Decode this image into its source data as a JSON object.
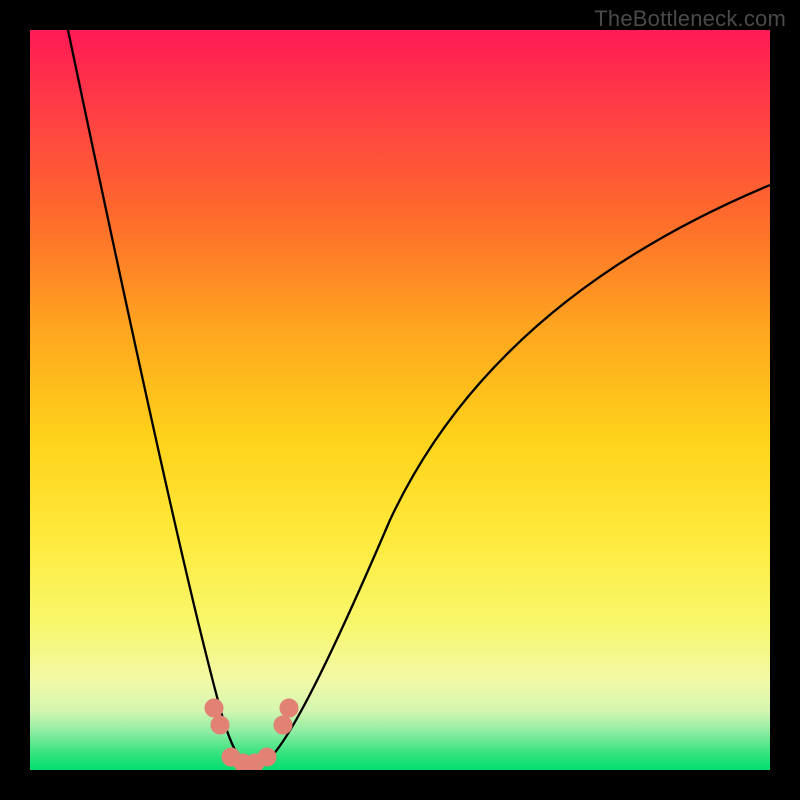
{
  "watermark": "TheBottleneck.com",
  "chart_data": {
    "type": "line",
    "title": "",
    "xlabel": "",
    "ylabel": "",
    "xlim": [
      0,
      100
    ],
    "ylim": [
      0,
      100
    ],
    "series": [
      {
        "name": "bottleneck-curve",
        "x": [
          5,
          10,
          15,
          20,
          24,
          26,
          28,
          30,
          32,
          34,
          36,
          40,
          50,
          60,
          70,
          80,
          90,
          100
        ],
        "y": [
          100,
          75,
          52,
          30,
          10,
          3,
          0,
          0,
          0,
          3,
          10,
          22,
          43,
          57,
          66,
          72,
          77,
          80
        ]
      }
    ],
    "markers": {
      "name": "highlighted-points",
      "x": [
        24.5,
        25.3,
        27.0,
        28.5,
        30.0,
        31.5,
        33.5,
        34.3
      ],
      "y": [
        8,
        6,
        1,
        0,
        0,
        1,
        6,
        8
      ]
    },
    "gradient_stops": [
      {
        "pos": 0,
        "color": "#ff1a55"
      },
      {
        "pos": 25,
        "color": "#ff6a2c"
      },
      {
        "pos": 55,
        "color": "#ffd21a"
      },
      {
        "pos": 88,
        "color": "#f2f9a8"
      },
      {
        "pos": 100,
        "color": "#00de6f"
      }
    ]
  }
}
